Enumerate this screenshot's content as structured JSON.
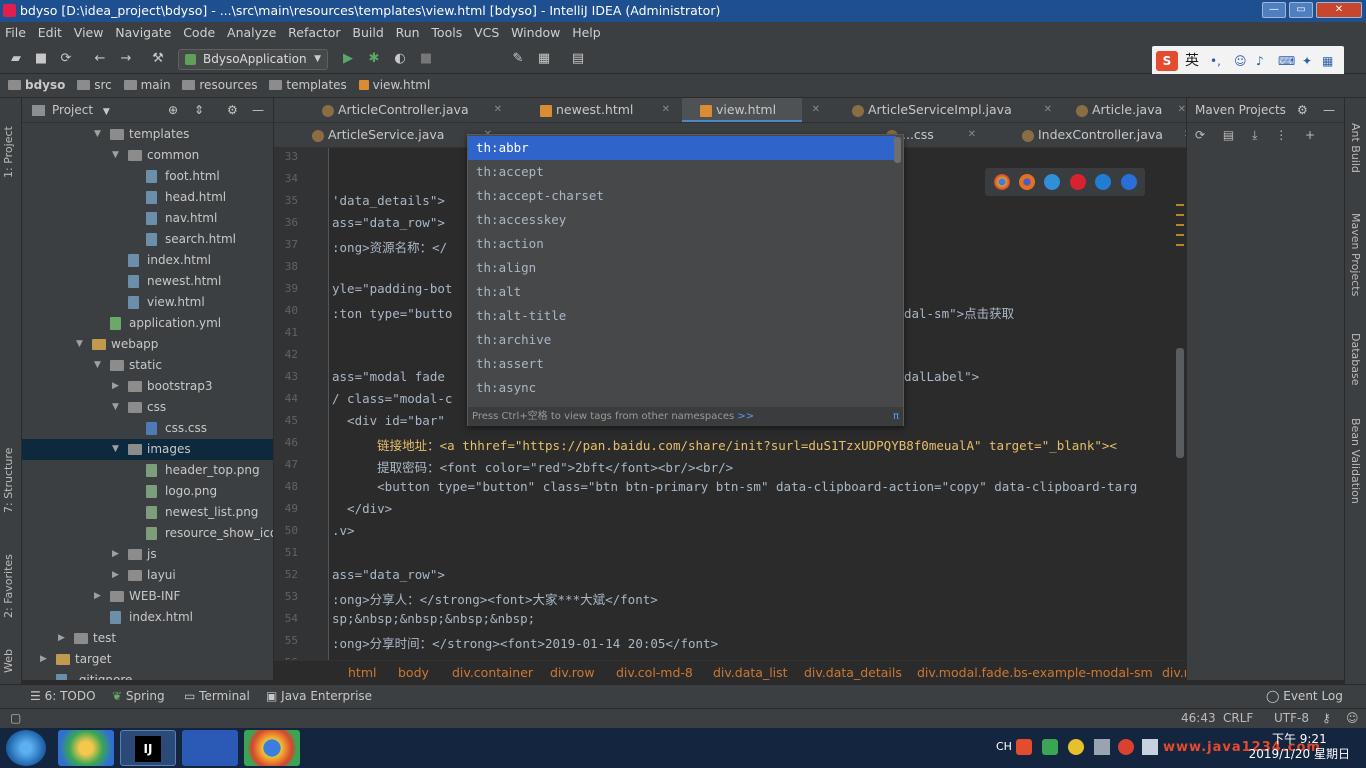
{
  "window": {
    "title": "bdyso [D:\\idea_project\\bdyso] - ...\\src\\main\\resources\\templates\\view.html [bdyso] - IntelliJ IDEA (Administrator)"
  },
  "menu": [
    "File",
    "Edit",
    "View",
    "Navigate",
    "Code",
    "Analyze",
    "Refactor",
    "Build",
    "Run",
    "Tools",
    "VCS",
    "Window",
    "Help"
  ],
  "toolbar": {
    "run_config": "BdysoApplication"
  },
  "ime": {
    "label": "英"
  },
  "breadcrumb": [
    "bdyso",
    "src",
    "main",
    "resources",
    "templates",
    "view.html"
  ],
  "project": {
    "title": "Project",
    "tree": [
      {
        "label": "templates",
        "depth": 4,
        "type": "folder",
        "open": true
      },
      {
        "label": "common",
        "depth": 5,
        "type": "folder",
        "open": true
      },
      {
        "label": "foot.html",
        "depth": 6,
        "type": "file"
      },
      {
        "label": "head.html",
        "depth": 6,
        "type": "file"
      },
      {
        "label": "nav.html",
        "depth": 6,
        "type": "file"
      },
      {
        "label": "search.html",
        "depth": 6,
        "type": "file"
      },
      {
        "label": "index.html",
        "depth": 5,
        "type": "file"
      },
      {
        "label": "newest.html",
        "depth": 5,
        "type": "file"
      },
      {
        "label": "view.html",
        "depth": 5,
        "type": "file"
      },
      {
        "label": "application.yml",
        "depth": 4,
        "type": "yml"
      },
      {
        "label": "webapp",
        "depth": 3,
        "type": "webfolder",
        "open": true
      },
      {
        "label": "static",
        "depth": 4,
        "type": "folder",
        "open": true
      },
      {
        "label": "bootstrap3",
        "depth": 5,
        "type": "folder",
        "open": false
      },
      {
        "label": "css",
        "depth": 5,
        "type": "folder",
        "open": true
      },
      {
        "label": "css.css",
        "depth": 6,
        "type": "css"
      },
      {
        "label": "images",
        "depth": 5,
        "type": "folder",
        "open": true,
        "selected": true
      },
      {
        "label": "header_top.png",
        "depth": 6,
        "type": "png"
      },
      {
        "label": "logo.png",
        "depth": 6,
        "type": "png"
      },
      {
        "label": "newest_list.png",
        "depth": 6,
        "type": "png"
      },
      {
        "label": "resource_show_icon.png",
        "depth": 6,
        "type": "png"
      },
      {
        "label": "js",
        "depth": 5,
        "type": "folder",
        "open": false
      },
      {
        "label": "layui",
        "depth": 5,
        "type": "folder",
        "open": false
      },
      {
        "label": "WEB-INF",
        "depth": 4,
        "type": "folder",
        "open": false
      },
      {
        "label": "index.html",
        "depth": 4,
        "type": "file"
      },
      {
        "label": "test",
        "depth": 2,
        "type": "folder",
        "open": false
      },
      {
        "label": "target",
        "depth": 1,
        "type": "webfolder",
        "open": false
      },
      {
        "label": ".gitignore",
        "depth": 1,
        "type": "file"
      }
    ]
  },
  "left_tools": [
    "1: Project",
    "7: Structure",
    "2: Favorites",
    "Web"
  ],
  "tabs_row1": [
    {
      "label": "ArticleController.java",
      "icon": "java"
    },
    {
      "label": "newest.html",
      "icon": "html"
    },
    {
      "label": "view.html",
      "icon": "html",
      "active": true
    },
    {
      "label": "ArticleServiceImpl.java",
      "icon": "java"
    },
    {
      "label": "Article.java",
      "icon": "java"
    }
  ],
  "tabs_row2": [
    {
      "label": "ArticleService.java",
      "icon": "java"
    },
    {
      "label": "...css",
      "icon": "css"
    },
    {
      "label": "IndexController.java",
      "icon": "java"
    }
  ],
  "editor": {
    "line_numbers": [
      "33",
      "34",
      "35",
      "36",
      "37",
      "38",
      "39",
      "40",
      "41",
      "42",
      "43",
      "44",
      "45",
      "46",
      "47",
      "48",
      "49",
      "50",
      "51",
      "52",
      "53",
      "54",
      "55",
      "56"
    ],
    "lines": [
      "",
      "",
      "'data_details\">",
      "ass=\"data_row\">",
      ":ong>资源名称：</",
      "",
      "yle=\"padding-bot",
      ":ton type=\"butto                                        rget=\".bs-example-modal-sm\">点击获取",
      "",
      "",
      "ass=\"modal fade                                        labelledby=\"mySmallModalLabel\">",
      "/ class=\"modal-c                                        rgin-top: 300px;\">",
      "  <div id=\"bar\"",
      "      链接地址：<a thhref=\"https://pan.baidu.com/share/init?surl=duS1TzxUDPQYB8f0meualA\" target=\"_blank\"><",
      "      提取密码：<font color=\"red\">2bft</font><br/><br/>",
      "      <button type=\"button\" class=\"btn btn-primary btn-sm\" data-clipboard-action=\"copy\" data-clipboard-targ",
      "  </div>",
      ".v>",
      "",
      "ass=\"data_row\">",
      ":ong>分享人：</strong><font>大家***大斌</font>",
      "sp;&nbsp;&nbsp;&nbsp;&nbsp;",
      ":ong>分享时间：</strong><font>2019-01-14 20:05</font>",
      ""
    ]
  },
  "completion": {
    "items": [
      "th:abbr",
      "th:accept",
      "th:accept-charset",
      "th:accesskey",
      "th:action",
      "th:align",
      "th:alt",
      "th:alt-title",
      "th:archive",
      "th:assert",
      "th:async"
    ],
    "footer": "Press Ctrl+空格 to view tags from other namespaces",
    "footer_link": ">>",
    "footer_pi": "π"
  },
  "editor_breadcrumb": [
    "html",
    "body",
    "div.container",
    "div.row",
    "div.col-md-8",
    "div.data_list",
    "div.data_details",
    "div.modal.fade.bs-example-modal-sm",
    "div.r"
  ],
  "maven": {
    "title": "Maven Projects"
  },
  "right_tools": [
    "Ant Build",
    "Maven Projects",
    "Database",
    "Bean Validation"
  ],
  "bottom_tools": [
    "6: TODO",
    "Spring",
    "Terminal",
    "Java Enterprise",
    "Event Log"
  ],
  "status": {
    "position": "46:43",
    "line_sep": "CRLF",
    "encoding": "UTF-8"
  },
  "taskbar": {
    "tray_lang": "CH",
    "clock_time": "下午 9:21",
    "clock_date": "2019/1/20 星期日"
  },
  "watermark": "www.java1234.com",
  "colors": {
    "accent": "#4a88c7",
    "selection": "#2f65ca",
    "titlebar": "#1e4f8f"
  }
}
